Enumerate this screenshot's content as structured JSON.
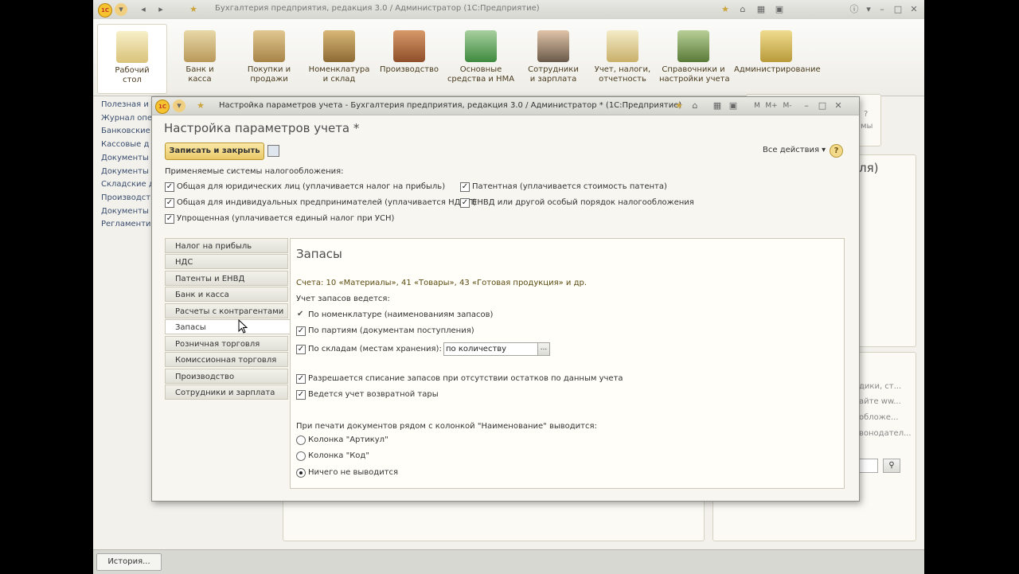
{
  "window": {
    "title": "Бухгалтерия предприятия, редакция 3.0 / Администратор  (1С:Предприятие)"
  },
  "sections": [
    {
      "label": "Рабочий\nстол"
    },
    {
      "label": "Банк и\nкасса"
    },
    {
      "label": "Покупки и\nпродажи"
    },
    {
      "label": "Номенклатура\nи склад"
    },
    {
      "label": "Производство"
    },
    {
      "label": "Основные\nсредства и НМА"
    },
    {
      "label": "Сотрудники\nи зарплата"
    },
    {
      "label": "Учет, налоги,\nотчетность"
    },
    {
      "label": "Справочники и\nнастройки учета"
    },
    {
      "label": "Администрирование"
    }
  ],
  "leftnav": [
    "Полезная и",
    "Журнал опе",
    "Банковские",
    "Кассовые д",
    "Документы",
    "Документы",
    "Складские д",
    "Производст",
    "Документы",
    "Регламенти"
  ],
  "background": {
    "right_fragments": [
      "?",
      "мы",
      "ля)",
      "дики, ст...",
      "айте ww...",
      "обложе...",
      "вонодател..."
    ]
  },
  "statusbar": {
    "history_label": "История..."
  },
  "dialog": {
    "title": "Настройка параметров учета - Бухгалтерия предприятия, редакция 3.0 / Администратор * (1С:Предприятие)",
    "form_title": "Настройка параметров учета *",
    "save_close_label": "Записать и закрыть",
    "all_actions_label": "Все действия ▾",
    "help_label": "?",
    "tax_systems_label": "Применяемые системы налогообложения:",
    "tax_systems": [
      {
        "label": "Общая для юридических лиц (уплачивается налог на прибыль)",
        "checked": true
      },
      {
        "label": "Общая для индивидуальных предпринимателей (уплачивается НДФЛ)",
        "checked": true
      },
      {
        "label": "Упрощенная (уплачивается единый налог при УСН)",
        "checked": true
      },
      {
        "label": "Патентная (уплачивается стоимость патента)",
        "checked": true
      },
      {
        "label": "ЕНВД или другой особый порядок налогообложения",
        "checked": true
      }
    ],
    "tabs": [
      {
        "label": "Налог на прибыль"
      },
      {
        "label": "НДС"
      },
      {
        "label": "Патенты и ЕНВД"
      },
      {
        "label": "Банк и касса"
      },
      {
        "label": "Расчеты с контрагентами"
      },
      {
        "label": "Запасы",
        "active": true
      },
      {
        "label": "Розничная торговля"
      },
      {
        "label": "Комиссионная торговля"
      },
      {
        "label": "Производство"
      },
      {
        "label": "Сотрудники и зарплата"
      }
    ],
    "content": {
      "title": "Запасы",
      "accounts_note": "Счета: 10 «Материалы», 41 «Товары», 43 «Готовая продукция» и др.",
      "inventory_label": "Учет запасов ведется:",
      "by_nomenclature": "По номенклатуре (наименованиям запасов)",
      "by_batches": "По партиям (документам поступления)",
      "by_warehouses": "По складам (местам хранения):",
      "warehouse_mode": "по количеству",
      "warehouse_mode_btn": "...",
      "allow_writeoff": "Разрешается списание запасов при отсутствии остатков по данным учета",
      "returnable_tare": "Ведется учет возвратной тары",
      "print_label": "При печати документов рядом с колонкой \"Наименование\" выводится:",
      "print_options": [
        {
          "label": "Колонка \"Артикул\"",
          "selected": false
        },
        {
          "label": "Колонка \"Код\"",
          "selected": false
        },
        {
          "label": "Ничего не выводится",
          "selected": true
        }
      ]
    }
  },
  "colors": {
    "accent": "#f5c330",
    "save_button": "#eac867",
    "link": "#3a4d6e"
  }
}
